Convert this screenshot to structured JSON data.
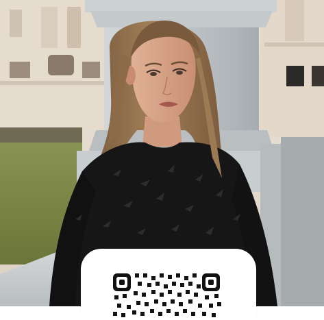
{
  "image": {
    "subject": "woman-portrait",
    "accent_colors": {
      "building": "#e8ddd0",
      "pillar": "#c3c8cb",
      "dress": "#161616",
      "hair": "#8b6a47",
      "grass": "#7c8a47"
    }
  },
  "qr_card": {
    "background": "#ffffff",
    "code_icon": "qr-code-icon"
  }
}
